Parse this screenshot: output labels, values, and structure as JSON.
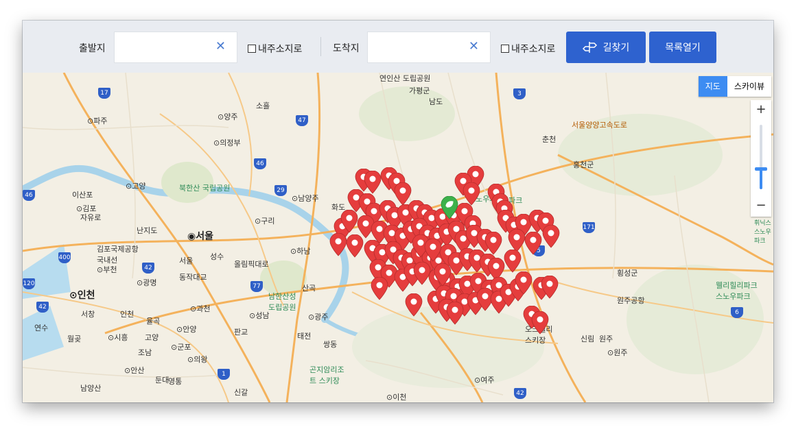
{
  "toolbar": {
    "origin_label": "출발지",
    "origin_value": "",
    "origin_clear": "✕",
    "origin_my_location": "내주소지로",
    "dest_label": "도착지",
    "dest_value": "",
    "dest_clear": "✕",
    "dest_my_location": "내주소지로",
    "route_button": "길찾기",
    "list_button": "목록열기",
    "accent_color": "#2e62cf"
  },
  "map": {
    "type_options": [
      {
        "label": "지도",
        "selected": true
      },
      {
        "label": "스카이뷰",
        "selected": false
      }
    ],
    "zoom_in": "+",
    "zoom_out": "−",
    "marker_color": "#e53d3d",
    "selected_marker_color": "#3db14b",
    "place_labels": [
      "연인산 도립공원",
      "가평군",
      "남도",
      "춘천",
      "서울양양고속도로",
      "홍천군",
      "⊙파주",
      "⊙양주",
      "소흘",
      "⊙의정부",
      "⊙고양",
      "북한산 국립공원",
      "⊙남양주",
      "이산포",
      "⊙김포",
      "자유로",
      "⊙구리",
      "난지도",
      "◉서울",
      "김포국제공항 국내선",
      "⊙하남",
      "성수",
      "올림픽대로",
      "⊙부천",
      "⊙광명",
      "동작대교",
      "남한산성 도립공원",
      "⊙인천",
      "⊙과천",
      "⊙성남",
      "⊙광주",
      "⊙안양",
      "⊙시흥",
      "⊙군포",
      "⊙의왕",
      "⊙안산",
      "곤지암리조트 스키장",
      "⊙여주",
      "⊙이천",
      "횡성군",
      "원주공항",
      "오크밸리 스키장",
      "⊙원주",
      "웰리힐리파크 스노우파크",
      "스노우파크",
      "디파크",
      "휘닉스 스노우파크",
      "화도",
      "서창",
      "연수",
      "월곶",
      "인천",
      "율곡",
      "판교",
      "태전",
      "쌍동",
      "신갈",
      "산곡",
      "영통",
      "신림",
      "원주",
      "고양",
      "남양산",
      "조남",
      "둔대",
      "서울"
    ],
    "highway_numbers": [
      "17",
      "47",
      "46",
      "29",
      "46",
      "400",
      "120",
      "42",
      "77",
      "3",
      "171",
      "5",
      "6",
      "42",
      "42",
      "1"
    ]
  }
}
